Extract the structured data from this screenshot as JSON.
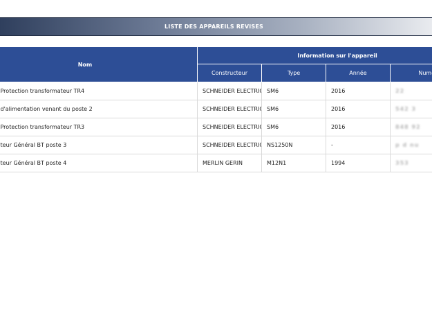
{
  "title": "LISTE DES APPAREILS REVISES",
  "headers": {
    "nom": "Nom",
    "info_group": "Information sur l'appareil",
    "constructeur": "Constructeur",
    "type": "Type",
    "annee": "Année",
    "numero": "Numéro de"
  },
  "rows": [
    {
      "nom": "Protection transformateur TR4",
      "constructeur": "SCHNEIDER ELECTRIC",
      "type": "SM6",
      "annee": "2016",
      "numero": "22"
    },
    {
      "nom": "d'alimentation venant du poste 2",
      "constructeur": "SCHNEIDER ELECTRIC",
      "type": "SM6",
      "annee": "2016",
      "numero": "542  3"
    },
    {
      "nom": "Protection transformateur TR3",
      "constructeur": "SCHNEIDER ELECTRIC",
      "type": "SM6",
      "annee": "2016",
      "numero": "848 92"
    },
    {
      "nom": "teur Général BT poste 3",
      "constructeur": "SCHNEIDER ELECTRIC",
      "type": "NS1250N",
      "annee": "-",
      "numero": "p  d  nu"
    },
    {
      "nom": "teur Général BT poste 4",
      "constructeur": "MERLIN GERIN",
      "type": "M12N1",
      "annee": "1994",
      "numero": "353"
    }
  ]
}
